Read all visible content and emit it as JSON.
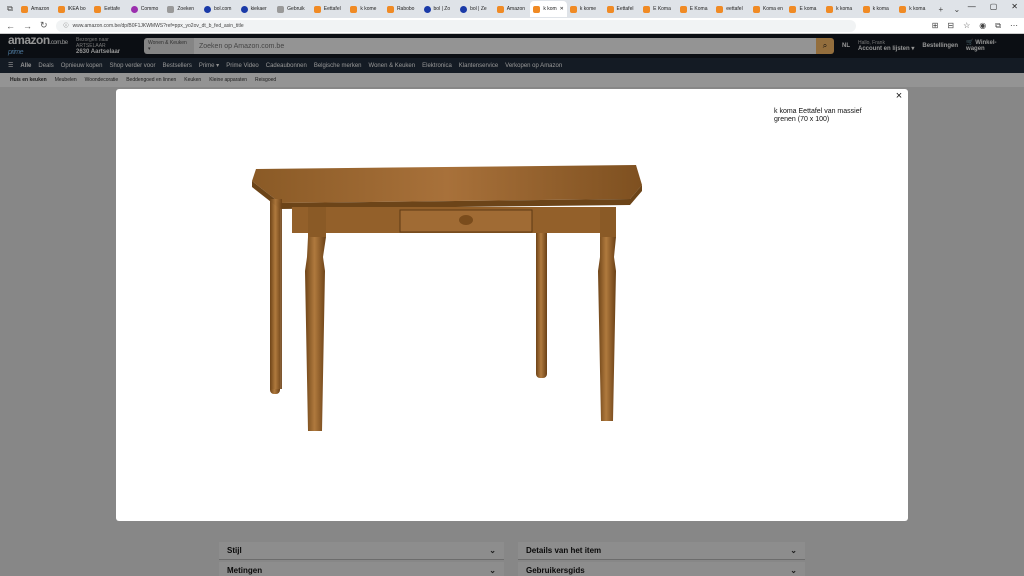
{
  "browser": {
    "tabs": [
      {
        "label": "Amazon",
        "fav": "orange"
      },
      {
        "label": "IKEA bo",
        "fav": "orange"
      },
      {
        "label": "Eettafe",
        "fav": "orange"
      },
      {
        "label": "Commo",
        "fav": "purple"
      },
      {
        "label": "Zoeken",
        "fav": "grey"
      },
      {
        "label": "bol.com",
        "fav": "blue"
      },
      {
        "label": "kiekaer",
        "fav": "blue"
      },
      {
        "label": "Gebruik",
        "fav": "grey"
      },
      {
        "label": "Eettafel",
        "fav": "orange"
      },
      {
        "label": "k kome",
        "fav": "orange"
      },
      {
        "label": "Rabobo",
        "fav": "orange"
      },
      {
        "label": "bol | Zo",
        "fav": "blue"
      },
      {
        "label": "bol | Ze",
        "fav": "blue"
      },
      {
        "label": "Amazon",
        "fav": "orange"
      },
      {
        "label": "k kom",
        "fav": "orange",
        "active": true
      },
      {
        "label": "k kome",
        "fav": "orange"
      },
      {
        "label": "Eettafel",
        "fav": "orange"
      },
      {
        "label": "E Koma",
        "fav": "orange"
      },
      {
        "label": "E Koma",
        "fav": "orange"
      },
      {
        "label": "eettafel",
        "fav": "orange"
      },
      {
        "label": "Koma en",
        "fav": "orange"
      },
      {
        "label": "E koma",
        "fav": "orange"
      },
      {
        "label": "k koma",
        "fav": "orange"
      },
      {
        "label": "k koma",
        "fav": "orange"
      },
      {
        "label": "k koma",
        "fav": "orange"
      }
    ],
    "url": "www.amazon.com.be/dp/B0F1JKWMWS?ref=ppx_yo2ov_dt_b_fed_asin_title",
    "window_controls": [
      "—",
      "▢",
      "✕"
    ]
  },
  "header": {
    "logo": "amazon",
    "logo_tld": ".com.be",
    "prime": "prime",
    "deliver_line1": "Bezorgen naar ARTSELAAR",
    "deliver_line2": "2630 Aartselaar",
    "search_category": "Wonen & Keuken ▾",
    "search_placeholder": "Zoeken op Amazon.com.be",
    "lang": "NL",
    "account_line1": "Hallo, Frank",
    "account_line2": "Account en lijsten ▾",
    "orders": "Bestellingen",
    "cart_line1": "Winkel-",
    "cart_line2": "wagen"
  },
  "nav": {
    "items": [
      "Alle",
      "Deals",
      "Opnieuw kopen",
      "Shop verder voor",
      "Bestsellers",
      "Prime ▾",
      "Prime Video",
      "Cadeaubonnen",
      "Belgische merken",
      "Wonen & Keuken",
      "Elektronica",
      "Klantenservice",
      "Verkopen op Amazon"
    ]
  },
  "subnav": {
    "items": [
      "Huis en keuken",
      "Meubelen",
      "Woondecoratie",
      "Beddengoed en linnen",
      "Keuken",
      "Kleine apparaten",
      "Reisgoed"
    ]
  },
  "modal": {
    "title": "k koma Eettafel van massief grenen (70 x 100)",
    "close": "×"
  },
  "background": {
    "accordion_left": [
      "Stijl",
      "Metingen"
    ],
    "accordion_right": [
      "Details van het item",
      "Gebruikersgids"
    ]
  }
}
